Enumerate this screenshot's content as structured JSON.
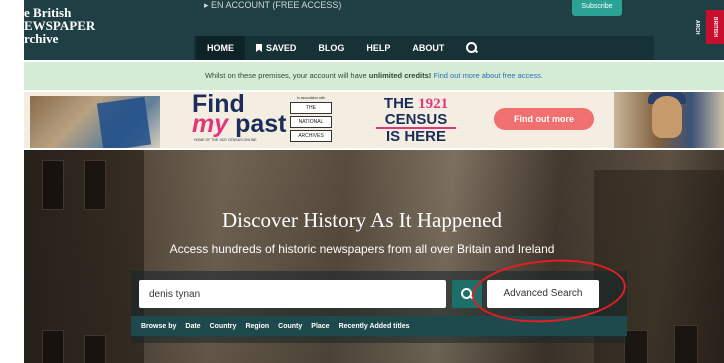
{
  "header": {
    "logo_lines": [
      "e British",
      "EWSPAPER",
      "rchive"
    ],
    "account_text": "▸ EN ACCOUNT (FREE ACCESS)",
    "subscribe_label": "Subscribe",
    "badge_text": "BRITISH ARCH",
    "nav": {
      "home": "HOME",
      "saved": "SAVED",
      "blog": "BLOG",
      "help": "HELP",
      "about": "ABOUT"
    }
  },
  "notice": {
    "prefix": "Whilst on these premises, your account will have ",
    "bold": "unlimited credits!",
    "link": " Find out more about free access."
  },
  "ad": {
    "find": "Find",
    "my": "my",
    "past": "past",
    "fmp_sub": "HOME OF THE 1921 CENSUS ONLINE",
    "na_tag": "In association with",
    "na_lines": [
      "THE",
      "NATIONAL",
      "ARCHIVES"
    ],
    "census_the": "THE",
    "census_year": "1921",
    "census_word": "CENSUS",
    "census_is_here": "IS HERE",
    "cta": "Find out more"
  },
  "hero": {
    "title": "Discover History As It Happened",
    "subtitle": "Access hundreds of historic newspapers from all over Britain and Ireland"
  },
  "search": {
    "value": "denis tynan",
    "advanced_label": "Advanced Search"
  },
  "browse": {
    "label": "Browse by",
    "items": [
      "Date",
      "Country",
      "Region",
      "County",
      "Place",
      "Recently Added titles"
    ]
  },
  "colors": {
    "header_bg": "#1f3f44",
    "notice_bg": "#d4ecd6",
    "accent_pink": "#e2367b",
    "annotation_red": "#e31e24"
  }
}
